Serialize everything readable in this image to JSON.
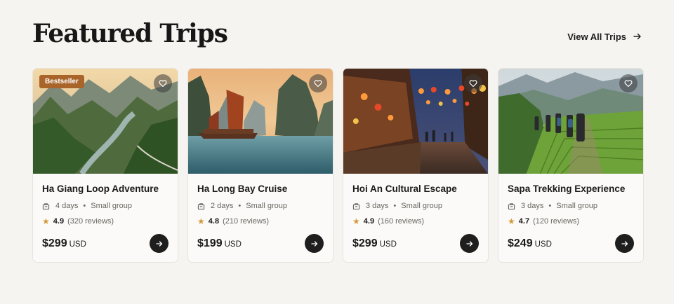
{
  "header": {
    "title": "Featured Trips",
    "view_all": "View All Trips"
  },
  "colors": {
    "background": "#f6f4f0",
    "badge": "#a9642a",
    "star": "#d39a3a",
    "button": "#1e1e1e"
  },
  "cards": [
    {
      "name": "Ha Giang Loop Adventure",
      "badge": "Bestseller",
      "duration": "4 days",
      "group": "Small group",
      "rating": "4.9",
      "reviews": "(320 reviews)",
      "price": "$299",
      "currency": "USD",
      "image": "mountain-river-valley"
    },
    {
      "name": "Ha Long Bay Cruise",
      "duration": "2 days",
      "group": "Small group",
      "rating": "4.8",
      "reviews": "(210 reviews)",
      "price": "$199",
      "currency": "USD",
      "image": "junk-boat-bay"
    },
    {
      "name": "Hoi An Cultural Escape",
      "duration": "3 days",
      "group": "Small group",
      "rating": "4.9",
      "reviews": "(160 reviews)",
      "price": "$299",
      "currency": "USD",
      "image": "lantern-street"
    },
    {
      "name": "Sapa Trekking Experience",
      "duration": "3 days",
      "group": "Small group",
      "rating": "4.7",
      "reviews": "(120 reviews)",
      "price": "$249",
      "currency": "USD",
      "image": "rice-terrace-hikers"
    }
  ],
  "icons": {
    "favorite": "heart-icon",
    "duration": "briefcase-icon",
    "rating": "star-icon",
    "arrow": "arrow-right-icon"
  }
}
